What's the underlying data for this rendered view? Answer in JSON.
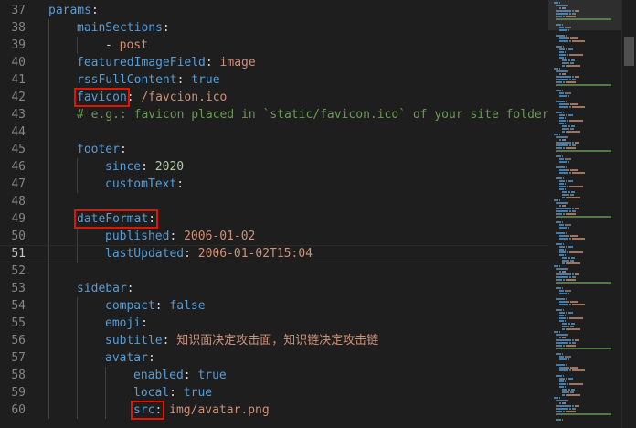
{
  "editor": {
    "lines": [
      {
        "n": "37",
        "indent": 0,
        "tokens": [
          {
            "t": "params",
            "c": "k"
          },
          {
            "t": ":",
            "c": "p"
          }
        ]
      },
      {
        "n": "38",
        "indent": 1,
        "tokens": [
          {
            "t": "mainSections",
            "c": "k"
          },
          {
            "t": ":",
            "c": "p"
          }
        ]
      },
      {
        "n": "39",
        "indent": 2,
        "tokens": [
          {
            "t": "- ",
            "c": "p"
          },
          {
            "t": "post",
            "c": "s"
          }
        ]
      },
      {
        "n": "40",
        "indent": 1,
        "tokens": [
          {
            "t": "featuredImageField",
            "c": "k"
          },
          {
            "t": ": ",
            "c": "p"
          },
          {
            "t": "image",
            "c": "s"
          }
        ]
      },
      {
        "n": "41",
        "indent": 1,
        "tokens": [
          {
            "t": "rssFullContent",
            "c": "k"
          },
          {
            "t": ": ",
            "c": "p"
          },
          {
            "t": "true",
            "c": "k"
          }
        ]
      },
      {
        "n": "42",
        "indent": 1,
        "tokens": [
          {
            "t": "favicon",
            "c": "k",
            "hl": true
          },
          {
            "t": ": ",
            "c": "p"
          },
          {
            "t": "/favcion.ico",
            "c": "s"
          }
        ]
      },
      {
        "n": "43",
        "indent": 1,
        "tokens": [
          {
            "t": "# e.g.: favicon placed in `static/favicon.ico` of your site folder, t",
            "c": "c"
          }
        ]
      },
      {
        "n": "44",
        "indent": 1,
        "tokens": []
      },
      {
        "n": "45",
        "indent": 1,
        "tokens": [
          {
            "t": "footer",
            "c": "k"
          },
          {
            "t": ":",
            "c": "p"
          }
        ]
      },
      {
        "n": "46",
        "indent": 2,
        "tokens": [
          {
            "t": "since",
            "c": "k"
          },
          {
            "t": ": ",
            "c": "p"
          },
          {
            "t": "2020",
            "c": "n"
          }
        ]
      },
      {
        "n": "47",
        "indent": 2,
        "tokens": [
          {
            "t": "customText",
            "c": "k"
          },
          {
            "t": ":",
            "c": "p"
          }
        ]
      },
      {
        "n": "48",
        "indent": 1,
        "tokens": []
      },
      {
        "n": "49",
        "indent": 1,
        "tokens": [
          {
            "t": "dateFormat",
            "c": "k",
            "hl": true
          },
          {
            "t": ":",
            "c": "p",
            "hl": true
          }
        ]
      },
      {
        "n": "50",
        "indent": 2,
        "tokens": [
          {
            "t": "published",
            "c": "k"
          },
          {
            "t": ": ",
            "c": "p"
          },
          {
            "t": "2006-01-02",
            "c": "s"
          }
        ]
      },
      {
        "n": "51",
        "indent": 2,
        "current": true,
        "tokens": [
          {
            "t": "lastUpdated",
            "c": "k"
          },
          {
            "t": ": ",
            "c": "p"
          },
          {
            "t": "2006-01-02T15:04",
            "c": "s"
          }
        ]
      },
      {
        "n": "52",
        "indent": 1,
        "tokens": []
      },
      {
        "n": "53",
        "indent": 1,
        "tokens": [
          {
            "t": "sidebar",
            "c": "k"
          },
          {
            "t": ":",
            "c": "p"
          }
        ]
      },
      {
        "n": "54",
        "indent": 2,
        "tokens": [
          {
            "t": "compact",
            "c": "k"
          },
          {
            "t": ": ",
            "c": "p"
          },
          {
            "t": "false",
            "c": "k"
          }
        ]
      },
      {
        "n": "55",
        "indent": 2,
        "tokens": [
          {
            "t": "emoji",
            "c": "k"
          },
          {
            "t": ":",
            "c": "p"
          }
        ]
      },
      {
        "n": "56",
        "indent": 2,
        "tokens": [
          {
            "t": "subtitle",
            "c": "k"
          },
          {
            "t": ": ",
            "c": "p"
          },
          {
            "t": "知识面决定攻击面，知识链决定攻击链",
            "c": "s"
          }
        ]
      },
      {
        "n": "57",
        "indent": 2,
        "tokens": [
          {
            "t": "avatar",
            "c": "k"
          },
          {
            "t": ":",
            "c": "p"
          }
        ]
      },
      {
        "n": "58",
        "indent": 3,
        "tokens": [
          {
            "t": "enabled",
            "c": "k"
          },
          {
            "t": ": ",
            "c": "p"
          },
          {
            "t": "true",
            "c": "k"
          }
        ]
      },
      {
        "n": "59",
        "indent": 3,
        "tokens": [
          {
            "t": "local",
            "c": "k"
          },
          {
            "t": ": ",
            "c": "p"
          },
          {
            "t": "true",
            "c": "k"
          }
        ]
      },
      {
        "n": "60",
        "indent": 3,
        "tokens": [
          {
            "t": "src",
            "c": "k",
            "hl": true
          },
          {
            "t": ":",
            "c": "p",
            "hl": true
          },
          {
            "t": " img/avatar.png",
            "c": "s"
          }
        ]
      }
    ]
  },
  "minimap": {
    "colors": {
      "key": "#569cd6",
      "string": "#ce9178",
      "comment": "#6a9955",
      "plain": "#8a8a8a"
    }
  },
  "colors": {
    "background": "#1e1e1e",
    "keyword": "#569cd6",
    "string": "#ce9178",
    "comment": "#6a9955",
    "number": "#b5cea8",
    "highlight_box": "#e51400"
  }
}
